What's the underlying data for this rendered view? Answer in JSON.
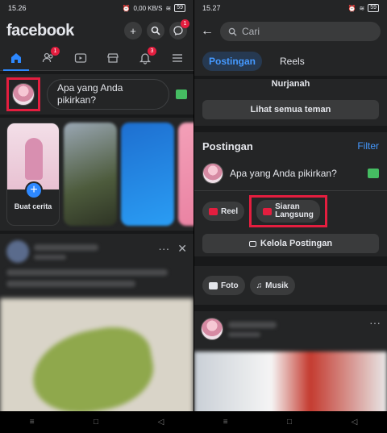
{
  "left": {
    "status": {
      "time": "15.26",
      "net": "0,00 KB/S",
      "battery": "59"
    },
    "header": {
      "logo": "facebook",
      "messenger_badge": "1"
    },
    "nav": {
      "friends_badge": "1",
      "notif_badge": "3"
    },
    "composer": {
      "placeholder": "Apa yang Anda pikirkan?"
    },
    "stories": {
      "create_label": "Buat cerita",
      "plus": "+"
    },
    "post_actions": {
      "more": "···",
      "close": "✕"
    }
  },
  "right": {
    "status": {
      "time": "15.27",
      "battery": "59"
    },
    "search": {
      "placeholder": "Cari"
    },
    "tabs": {
      "postingan": "Postingan",
      "reels": "Reels"
    },
    "friends": {
      "name": "Nurjanah",
      "see_all": "Lihat semua teman"
    },
    "posts": {
      "title": "Postingan",
      "filter": "Filter",
      "composer_text": "Apa yang Anda pikirkan?",
      "reel_label": "Reel",
      "live_label": "Siaran Langsung",
      "manage_label": "Kelola Postingan"
    },
    "media": {
      "photo": "Foto",
      "music": "Musik"
    },
    "post_more": "···"
  },
  "colors": {
    "brand_blue": "#2d88ff",
    "highlight_red": "#e41e3f",
    "bg": "#18191a",
    "card": "#242526"
  }
}
